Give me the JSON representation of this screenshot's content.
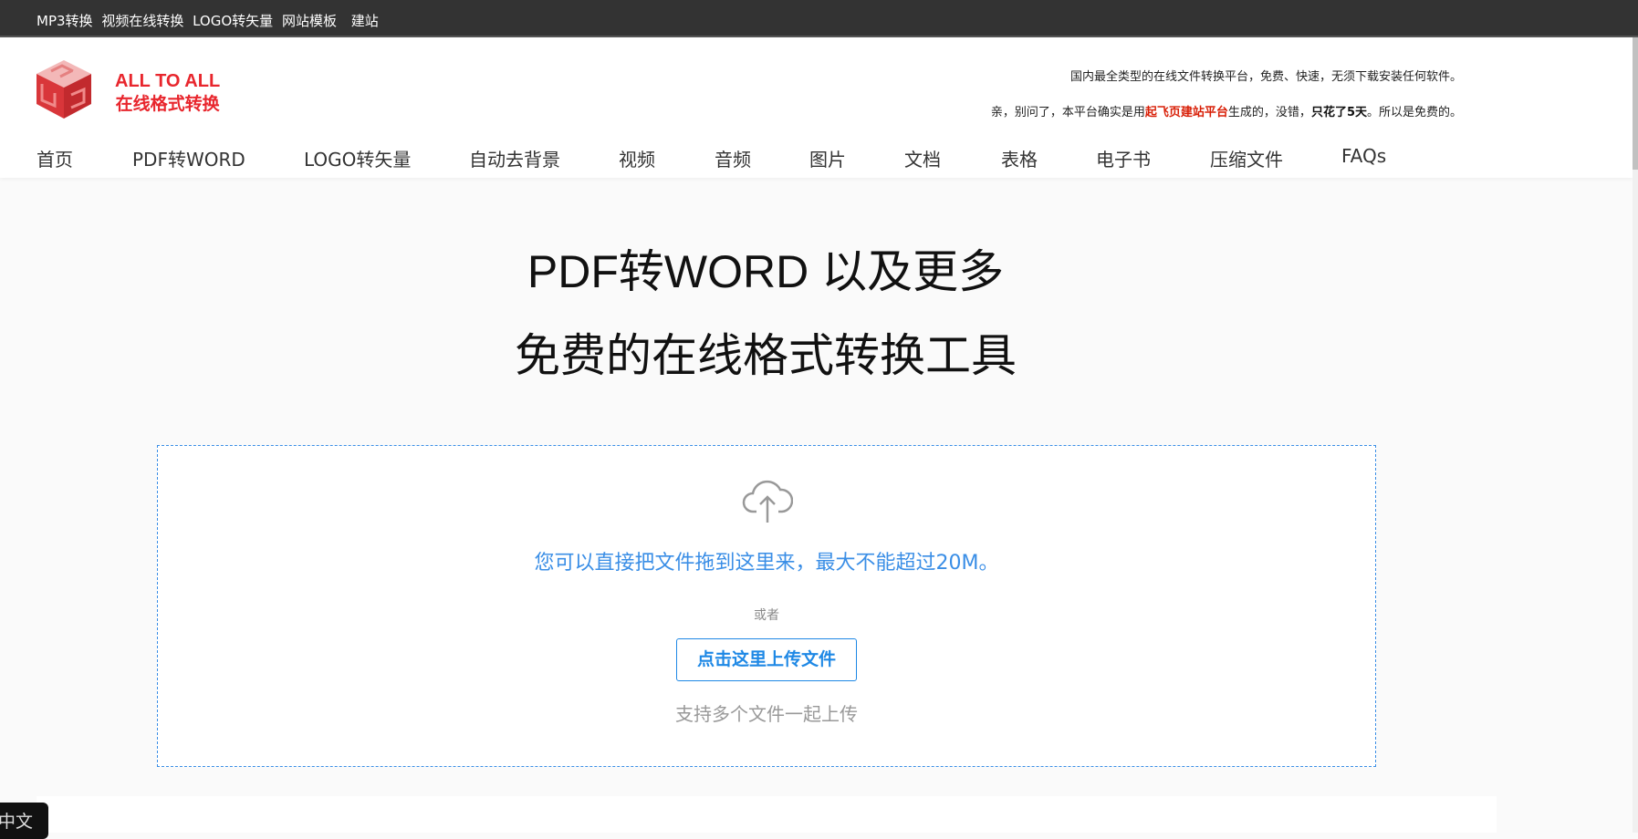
{
  "topbar": {
    "links": [
      "MP3转换",
      "视频在线转换",
      "LOGO转矢量",
      "网站模板",
      "建站"
    ]
  },
  "brand": {
    "name_en": "ALL TO ALL",
    "name_cn": "在线格式转换",
    "logo_color": "#e8262d"
  },
  "slogan": {
    "line1": "国内最全类型的在线文件转换平台，免费、快速，无须下载安装任何软件。",
    "line2_a": "亲，别问了，本平台确实是用",
    "line2_link": "起飞页建站平台",
    "line2_b": "生成的，没错，",
    "line2_bold": "只花了5天",
    "line2_c": "。所以是免费的。"
  },
  "nav": [
    "首页",
    "PDF转WORD",
    "LOGO转矢量",
    "自动去背景",
    "视频",
    "音频",
    "图片",
    "文档",
    "表格",
    "电子书",
    "压缩文件",
    "FAQs"
  ],
  "hero": {
    "line1": "PDF转WORD 以及更多",
    "line2": "免费的在线格式转换工具"
  },
  "upload": {
    "icon": "cloud-upload-icon",
    "hint": "您可以直接把文件拖到这里来，最大不能超过20M。",
    "or": "或者",
    "button": "点击这里上传文件",
    "multi": "支持多个文件一起上传",
    "accent": "#3a8ee6"
  },
  "language": {
    "label": "中文"
  }
}
